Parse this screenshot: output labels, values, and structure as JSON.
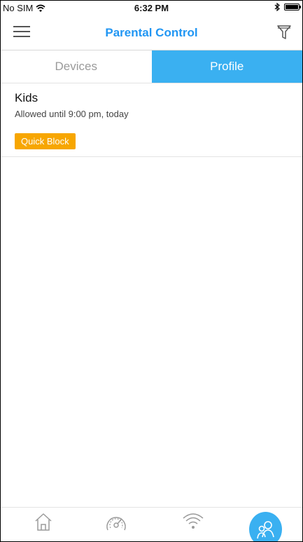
{
  "status_bar": {
    "carrier": "No SIM",
    "time": "6:32 PM",
    "icons": [
      "wifi-icon",
      "bluetooth-icon",
      "battery-icon"
    ]
  },
  "header": {
    "title": "Parental Control",
    "menu_icon": "menu-icon",
    "filter_icon": "filter-icon",
    "accent_color": "#2196f3"
  },
  "tabs": [
    {
      "label": "Devices",
      "selected": false
    },
    {
      "label": "Profile",
      "selected": true
    }
  ],
  "profile": {
    "name": "Kids",
    "status": "Allowed until 9:00 pm, today",
    "quick_block_label": "Quick Block",
    "button_color": "#f7a600"
  },
  "bottom_nav": {
    "items": [
      {
        "icon": "home-icon",
        "selected": false
      },
      {
        "icon": "speedometer-icon",
        "selected": false
      },
      {
        "icon": "wifi-icon",
        "selected": false
      },
      {
        "icon": "parental-control-icon",
        "selected": true
      }
    ],
    "active_color": "#3ab0f1"
  }
}
